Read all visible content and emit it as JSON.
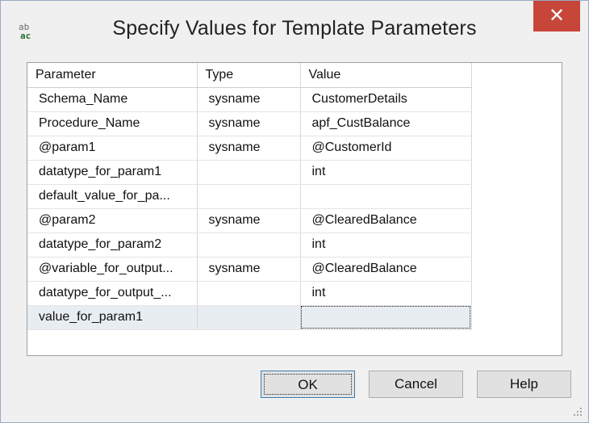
{
  "window": {
    "title": "Specify Values for Template Parameters",
    "icon_name": "template-parameters-icon",
    "icon_text_top": "ab",
    "icon_text_bottom": "ac",
    "close_glyph": "✕",
    "close_color": "#c7463a"
  },
  "grid": {
    "columns": [
      "Parameter",
      "Type",
      "Value"
    ],
    "rows": [
      {
        "parameter": "Schema_Name",
        "type": "sysname",
        "value": "CustomerDetails"
      },
      {
        "parameter": "Procedure_Name",
        "type": "sysname",
        "value": "apf_CustBalance"
      },
      {
        "parameter": "@param1",
        "type": "sysname",
        "value": "@CustomerId"
      },
      {
        "parameter": "datatype_for_param1",
        "type": "",
        "value": "int"
      },
      {
        "parameter": "default_value_for_pa...",
        "type": "",
        "value": ""
      },
      {
        "parameter": "@param2",
        "type": "sysname",
        "value": "@ClearedBalance"
      },
      {
        "parameter": "datatype_for_param2",
        "type": "",
        "value": "int"
      },
      {
        "parameter": "@variable_for_output...",
        "type": "sysname",
        "value": "@ClearedBalance"
      },
      {
        "parameter": "datatype_for_output_...",
        "type": "",
        "value": "int"
      },
      {
        "parameter": "value_for_param1",
        "type": "",
        "value": "",
        "selected": true
      }
    ]
  },
  "buttons": {
    "ok": "OK",
    "cancel": "Cancel",
    "help": "Help"
  }
}
